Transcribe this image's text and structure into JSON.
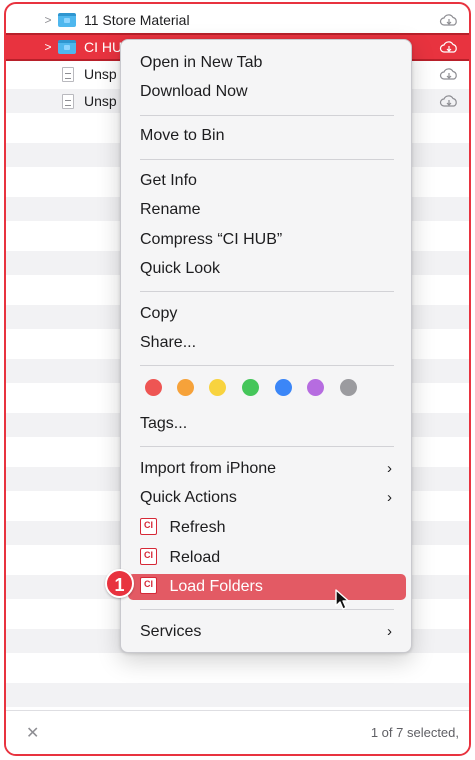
{
  "finder": {
    "rows": [
      {
        "name": "11 Store Material",
        "kind": "folder"
      },
      {
        "name": "CI HUB",
        "kind": "folder"
      },
      {
        "name": "Unsp",
        "kind": "document"
      },
      {
        "name": "Unsp",
        "kind": "document"
      }
    ],
    "status": {
      "text": "1 of 7 selected,",
      "close_glyph": "✕"
    }
  },
  "context_menu": {
    "items": {
      "open_new_tab": "Open in New Tab",
      "download_now": "Download Now",
      "move_to_bin": "Move to Bin",
      "get_info": "Get Info",
      "rename": "Rename",
      "compress": "Compress “CI HUB”",
      "quick_look": "Quick Look",
      "copy": "Copy",
      "share": "Share...",
      "tags": "Tags...",
      "import_iphone": "Import from iPhone",
      "quick_actions": "Quick Actions",
      "refresh": "Refresh",
      "reload": "Reload",
      "load_folders": "Load Folders",
      "services": "Services"
    },
    "submenu_arrow": "›",
    "ci_icon_text": "CI",
    "tag_colors": [
      "#ee5553",
      "#f6a23a",
      "#f8d33f",
      "#45c65a",
      "#3b86f7",
      "#b66ce0",
      "#9b9b9f"
    ]
  },
  "annotation": {
    "step_number": "1"
  },
  "colors": {
    "accent": "#e8333f",
    "highlight": "#e35a64",
    "folder": "#4fb7ee"
  },
  "icons": [
    "chevron-right-icon",
    "folder-icon",
    "document-icon",
    "cloud-download-icon",
    "close-icon",
    "ci-hub-icon",
    "pointer-cursor-icon"
  ]
}
